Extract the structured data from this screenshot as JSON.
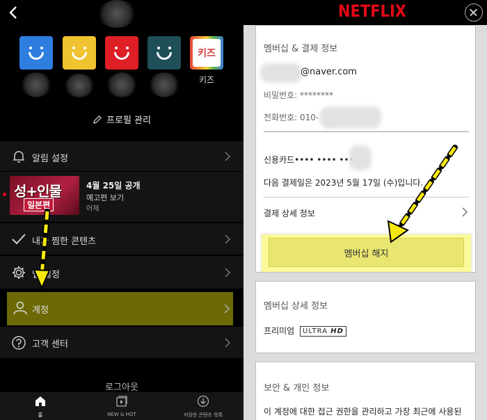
{
  "left": {
    "profiles": [
      {
        "name": "",
        "color": "#2e7ee0"
      },
      {
        "name": "",
        "color": "#f0c330"
      },
      {
        "name": "",
        "color": "#df1f26"
      },
      {
        "name": "",
        "color": "#1f4f59"
      },
      {
        "name": "키즈",
        "color": "#ffffff"
      }
    ],
    "kids_tile_text": "키즈",
    "profile_manage": "프로필 관리",
    "menu": {
      "notifications": "알림 설정",
      "my_list": "내가 찜한 콘텐츠",
      "app_settings": "앱 설정",
      "account": "계정",
      "help": "고객 센터"
    },
    "notification": {
      "thumb_title": "성+인물",
      "thumb_sub": "일본편",
      "date": "4월 25일 공개",
      "subtitle": "예고편 보기",
      "time": "어제"
    },
    "logout": "로그아웃",
    "bottom_nav": {
      "home": "홈",
      "new_hot": "NEW & HOT",
      "downloads": "저장한 콘텐츠 목록"
    }
  },
  "right": {
    "logo": "NETFLIX",
    "membership_section": {
      "title": "멤버십 & 결제 정보",
      "email": "@naver.com",
      "password": "비밀번호: ********",
      "phone": "전화번호: 010-",
      "card": "신용카드•••• •••• ••••",
      "next_payment": "다음 결제일은 2023년 5월 17일 (수)입니다.",
      "payment_details": "결제 상세 정보",
      "cancel_button": "멤버십 해지"
    },
    "plan_section": {
      "title": "멤버십 상세 정보",
      "plan": "프리미엄",
      "badge_a": "ULTRA",
      "badge_b": "HD"
    },
    "security_section": {
      "title": "보안 & 개인 정보",
      "body": "이 계정에 대한 접근 권한을 관리하고 가장 최근에 사용된"
    }
  },
  "colors": {
    "netflix_red": "#e50914",
    "highlight_yellow": "#fbf99a",
    "account_highlight": "#6b6a06",
    "arrow_yellow": "#f6e80f"
  }
}
